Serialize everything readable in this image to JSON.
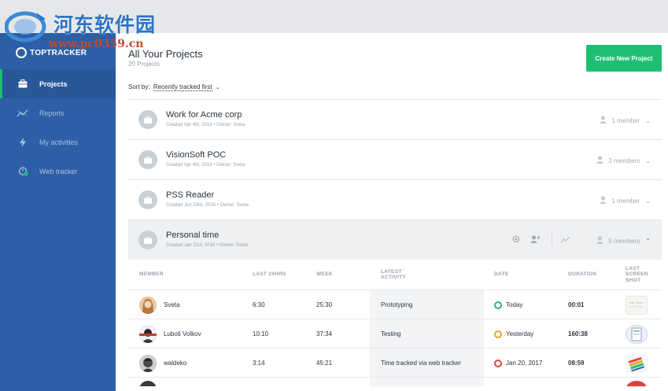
{
  "watermark": {
    "cn_text": "河东软件园",
    "url_text": "www.pc0359.cn"
  },
  "brand": {
    "name": "TOPTRACKER"
  },
  "sidebar": {
    "items": [
      {
        "label": "Projects",
        "icon": "briefcase-icon",
        "active": true
      },
      {
        "label": "Reports",
        "icon": "chart-line-icon",
        "active": false
      },
      {
        "label": "My activities",
        "icon": "lightning-icon",
        "active": false
      },
      {
        "label": "Web tracker",
        "icon": "web-tracker-icon",
        "active": false
      }
    ]
  },
  "header": {
    "title": "All Your Projects",
    "subtitle": "20 Projects",
    "create_label": "Create New Project"
  },
  "sort": {
    "label": "Sort by:",
    "value": "Recently tracked first"
  },
  "projects": [
    {
      "name": "Work for Acme corp",
      "meta": "Created Apr 4th, 2016 • Owner: Sveta",
      "members": "1 member",
      "expanded": false
    },
    {
      "name": "VisionSoft POC",
      "meta": "Created Apr 4th, 2016 • Owner: Sveta",
      "members": "3 members",
      "expanded": false
    },
    {
      "name": "PSS Reader",
      "meta": "Created Jun 23rd, 2016 • Owner: Sveta",
      "members": "1 member",
      "expanded": false
    },
    {
      "name": "Personal time",
      "meta": "Created Jan 21st, 2016 • Owner: Sveta",
      "members": "5 members",
      "expanded": true
    }
  ],
  "members_table": {
    "headers": {
      "member": "MEMBER",
      "last24": "LAST 24HRS",
      "week": "WEEK",
      "activity": [
        "LATEST",
        "ACTIVITY"
      ],
      "date": "DATE",
      "duration": "DURATION",
      "shot": [
        "LAST",
        "SCREEN",
        "SHOT"
      ]
    },
    "rows": [
      {
        "name": "Sveta",
        "last24": "6:30",
        "week": "25:30",
        "activity": "Prototyping",
        "date": "Today",
        "date_color": "#1fbf73",
        "duration": "00:01"
      },
      {
        "name": "Luboš Volkov",
        "last24": "10:10",
        "week": "37:34",
        "activity": "Testing",
        "date": "Yesterday",
        "date_color": "#f0a227",
        "duration": "160:38"
      },
      {
        "name": "waldeko",
        "last24": "3:14",
        "week": "45:21",
        "activity": "Time tracked via web tracker",
        "date": "Jan 20, 2017",
        "date_color": "#e4473d",
        "duration": "08:59"
      }
    ]
  },
  "colors": {
    "sidebar": "#2e5fa6",
    "accent": "#1fbf73"
  }
}
